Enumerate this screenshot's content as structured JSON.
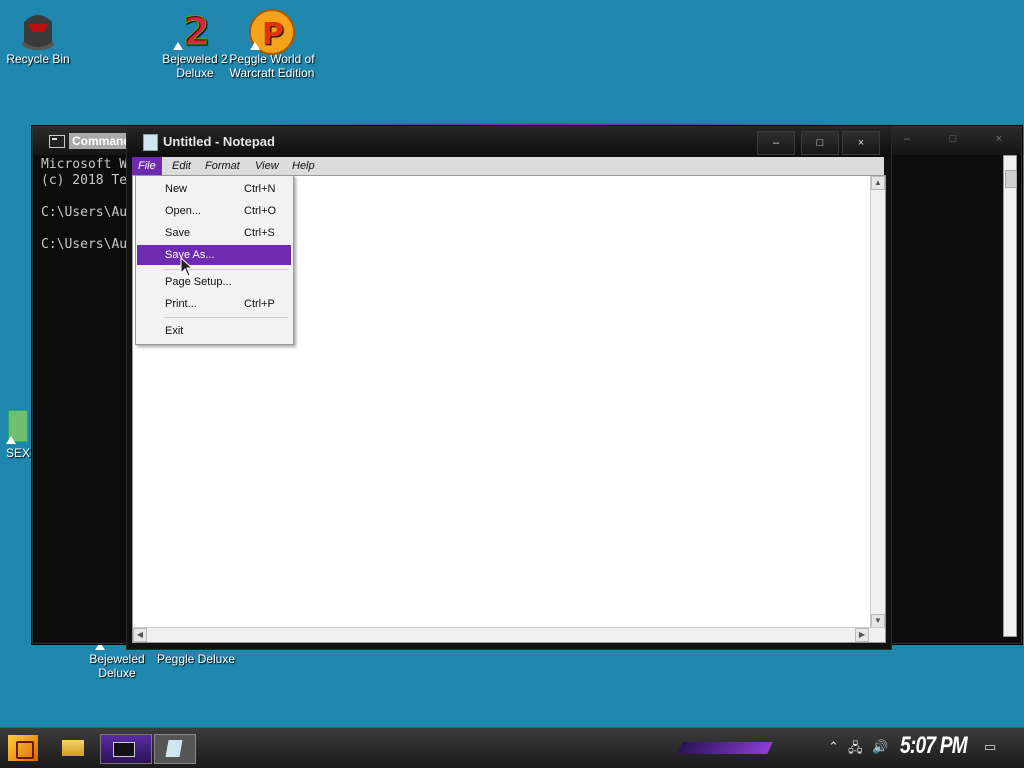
{
  "desktop": {
    "icons": [
      {
        "label": "Recycle Bin"
      },
      {
        "label": "Bejeweled 2\nDeluxe"
      },
      {
        "label": "Peggle World of\nWarcraft Edition"
      },
      {
        "label": "SEX"
      },
      {
        "label": "Bejeweled\nDeluxe"
      },
      {
        "label": "Peggle Deluxe"
      }
    ]
  },
  "cmd": {
    "title": "Command",
    "lines": [
      "Microsoft W",
      "(c) 2018 Te",
      "",
      "C:\\Users\\Au",
      "",
      "C:\\Users\\Au"
    ]
  },
  "notepad": {
    "title": "Untitled - Notepad",
    "menu": [
      "File",
      "Edit",
      "Format",
      "View",
      "Help"
    ],
    "controls": {
      "minimize": "–",
      "maximize": "□",
      "close": "×"
    }
  },
  "file_menu": {
    "items": [
      {
        "label": "New",
        "shortcut": "Ctrl+N"
      },
      {
        "label": "Open...",
        "shortcut": "Ctrl+O"
      },
      {
        "label": "Save",
        "shortcut": "Ctrl+S"
      },
      {
        "label": "Save As...",
        "shortcut": ""
      },
      {
        "label": "Page Setup...",
        "shortcut": ""
      },
      {
        "label": "Print...",
        "shortcut": "Ctrl+P"
      },
      {
        "label": "Exit",
        "shortcut": ""
      }
    ],
    "highlighted": "Save As..."
  },
  "taskbar": {
    "clock": "5:07 PM"
  },
  "colors": {
    "accent": "#6f2bb0",
    "desktop": "#1f86ad"
  }
}
